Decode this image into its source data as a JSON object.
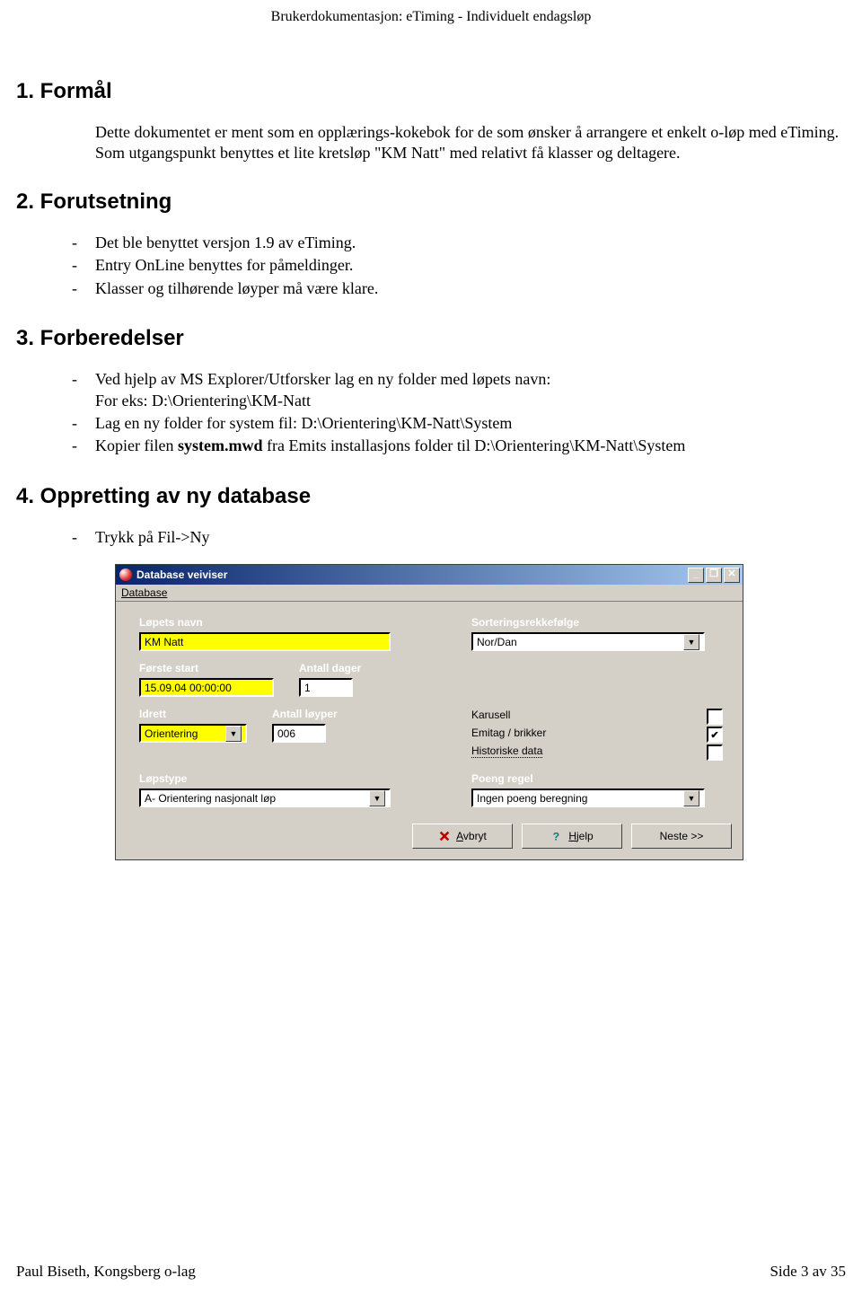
{
  "doc_header": "Brukerdokumentasjon: eTiming - Individuelt endagsløp",
  "sections": {
    "s1": {
      "title": "1. Formål",
      "para": "Dette dokumentet er ment som en opplærings-kokebok for de som ønsker å arrangere et enkelt o-løp med eTiming. Som utgangspunkt benyttes et lite kretsløp \"KM Natt\" med relativt få klasser og deltagere."
    },
    "s2": {
      "title": "2. Forutsetning",
      "bullets": [
        "Det ble benyttet versjon 1.9 av eTiming.",
        "Entry OnLine benyttes for påmeldinger.",
        "Klasser og tilhørende løyper må være klare."
      ]
    },
    "s3": {
      "title": "3. Forberedelser",
      "bullets_html": [
        "Ved hjelp av MS Explorer/Utforsker lag en ny folder med løpets navn:\nFor eks: D:\\Orientering\\KM-Natt",
        "Lag en ny folder for system fil:  D:\\Orientering\\KM-Natt\\System",
        "Kopier filen <b>system.mwd</b> fra Emits installasjons folder til D:\\Orientering\\KM-Natt\\System"
      ]
    },
    "s4": {
      "title": "4. Oppretting av ny database",
      "bullets": [
        "Trykk på Fil->Ny"
      ]
    }
  },
  "dialog": {
    "title": "Database veiviser",
    "menu": "Database",
    "left": {
      "lopets_navn_label": "Løpets navn",
      "lopets_navn_value": "KM Natt",
      "forste_start_label": "Første start",
      "forste_start_value": "15.09.04 00:00:00",
      "antall_dager_label": "Antall dager",
      "antall_dager_value": "1",
      "idrett_label": "Idrett",
      "idrett_value": "Orientering",
      "antall_loyper_label": "Antall løyper",
      "antall_loyper_value": "006",
      "lopstype_label": "Løpstype",
      "lopstype_value": "A- Orientering nasjonalt løp"
    },
    "right": {
      "sort_label": "Sorteringsrekkefølge",
      "sort_value": "Nor/Dan",
      "karusell": "Karusell",
      "emitag": "Emitag / brikker",
      "historiske": "Historiske data",
      "poeng_label": "Poeng regel",
      "poeng_value": "Ingen poeng beregning"
    },
    "buttons": {
      "avbryt": "Avbryt",
      "hjelp": "Hjelp",
      "neste": "Neste >>"
    }
  },
  "footer": {
    "left": "Paul Biseth, Kongsberg o-lag",
    "right": "Side 3 av 35"
  }
}
